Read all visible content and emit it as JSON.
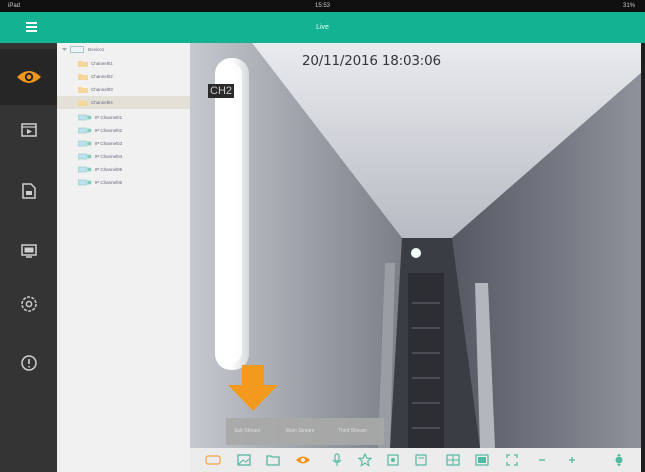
{
  "status_bar": {
    "left": "iPad",
    "center": "15:53",
    "right": "31%"
  },
  "header": {
    "title": "Live"
  },
  "sidebar": {
    "items": [
      {
        "id": "live",
        "icon": "eye-icon",
        "active": true
      },
      {
        "id": "playback",
        "icon": "playback-icon",
        "active": false
      },
      {
        "id": "files",
        "icon": "folder-icon",
        "active": false
      },
      {
        "id": "remote",
        "icon": "monitor-icon",
        "active": false
      },
      {
        "id": "settings",
        "icon": "gear-icon",
        "active": false
      },
      {
        "id": "info",
        "icon": "info-icon",
        "active": false
      }
    ]
  },
  "device_tree": {
    "root": "Device1",
    "channels": [
      {
        "label": "Channel01",
        "kind": "folder",
        "selected": false
      },
      {
        "label": "Channel02",
        "kind": "folder",
        "selected": false
      },
      {
        "label": "Channel03",
        "kind": "folder",
        "selected": false
      },
      {
        "label": "Channel04",
        "kind": "folder",
        "selected": true
      },
      {
        "label": "IP Channel01",
        "kind": "ip",
        "selected": false
      },
      {
        "label": "IP Channel02",
        "kind": "ip",
        "selected": false
      },
      {
        "label": "IP Channel03",
        "kind": "ip",
        "selected": false
      },
      {
        "label": "IP Channel04",
        "kind": "ip",
        "selected": false
      },
      {
        "label": "IP Channel05",
        "kind": "ip",
        "selected": false
      },
      {
        "label": "IP Channel06",
        "kind": "ip",
        "selected": false
      }
    ]
  },
  "video": {
    "timestamp": "20/11/2016 18:03:06",
    "channel_tag": "CH2",
    "stream_options": [
      "Sub Stream",
      "Main Stream",
      "Third Stream"
    ]
  },
  "toolbar": {
    "buttons": [
      "stream-icon",
      "image-icon",
      "folder-icon",
      "eye-icon",
      "mic-icon",
      "star-icon",
      "record-icon",
      "snapshot-icon",
      "grid-icon",
      "layout-icon",
      "fullscreen-icon",
      "zoom-out-icon",
      "zoom-in-icon",
      "ptz-icon"
    ]
  },
  "colors": {
    "accent": "#12b293",
    "sidebar": "#343434",
    "active_icon": "#f0961c",
    "arrow": "#f39a1e"
  }
}
